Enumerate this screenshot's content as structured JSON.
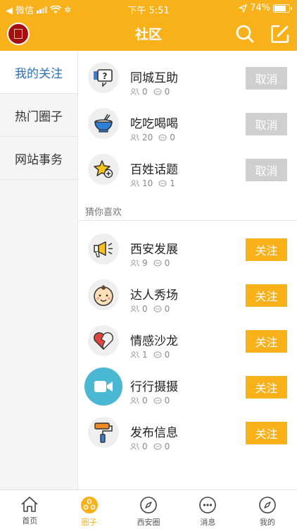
{
  "status_bar": {
    "carrier": "◀ 微信",
    "time": "下午 5:51",
    "battery": "74%"
  },
  "header": {
    "title": "社区"
  },
  "sidebar": {
    "items": [
      {
        "label": "我的关注"
      },
      {
        "label": "热门圈子"
      },
      {
        "label": "网站事务"
      }
    ]
  },
  "followed": [
    {
      "name": "同城互助",
      "members": "0",
      "posts": "0",
      "button": "取消",
      "icon": "help-sign-icon"
    },
    {
      "name": "吃吃喝喝",
      "members": "20",
      "posts": "0",
      "button": "取消",
      "icon": "food-bowl-icon"
    },
    {
      "name": "百姓话题",
      "members": "10",
      "posts": "1",
      "button": "取消",
      "icon": "star-plus-icon"
    }
  ],
  "recommend_label": "猜你喜欢",
  "recommended": [
    {
      "name": "西安发展",
      "members": "9",
      "posts": "0",
      "button": "关注",
      "icon": "megaphone-icon"
    },
    {
      "name": "达人秀场",
      "members": "0",
      "posts": "0",
      "button": "关注",
      "icon": "baby-face-icon"
    },
    {
      "name": "情感沙龙",
      "members": "1",
      "posts": "0",
      "button": "关注",
      "icon": "heart-icon"
    },
    {
      "name": "行行摄摄",
      "members": "0",
      "posts": "0",
      "button": "关注",
      "icon": "video-camera-icon"
    },
    {
      "name": "发布信息",
      "members": "0",
      "posts": "0",
      "button": "关注",
      "icon": "paint-roller-icon"
    }
  ],
  "tabbar": {
    "items": [
      {
        "label": "首页",
        "icon": "home-icon"
      },
      {
        "label": "圈子",
        "icon": "circle-icon"
      },
      {
        "label": "西安圈",
        "icon": "compass-icon"
      },
      {
        "label": "消息",
        "icon": "chat-icon"
      },
      {
        "label": "我的",
        "icon": "compass-icon"
      }
    ]
  },
  "colors": {
    "accent": "#f9b11a",
    "active_side": "#2f6fb8",
    "cancel_bg": "#cfcfcf"
  }
}
